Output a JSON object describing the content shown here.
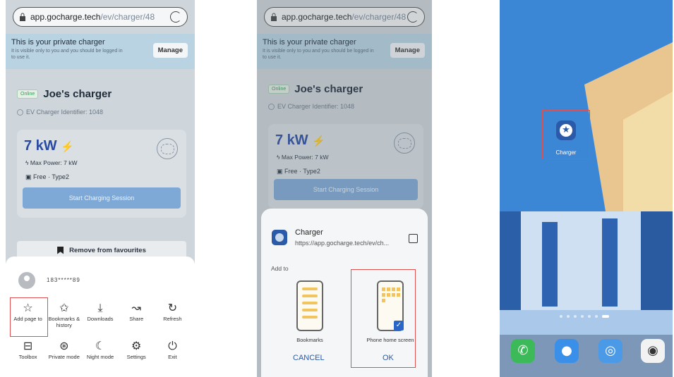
{
  "browser": {
    "url_host": "app.gocharge.tech",
    "url_path": "/ev/charger/48"
  },
  "private_banner": {
    "title": "This is your private charger",
    "subtitle": "It is visible only to you and you should be logged in to use it.",
    "manage_label": "Manage"
  },
  "charger": {
    "status": "Online",
    "name": "Joe's charger",
    "identifier": "EV Charger Identifier: 1048",
    "power": "7 kW",
    "max_power": "Max Power: 7 kW",
    "price_type": "Free · Type2",
    "start_label": "Start Charging Session"
  },
  "favourites_label": "Remove from favourites",
  "menu_sheet": {
    "username": "183*****89",
    "items": [
      {
        "label": "Add page to",
        "icon": "star-icon"
      },
      {
        "label": "Bookmarks & history",
        "icon": "bookmarks-icon"
      },
      {
        "label": "Downloads",
        "icon": "download-icon"
      },
      {
        "label": "Share",
        "icon": "share-icon"
      },
      {
        "label": "Refresh",
        "icon": "refresh-icon"
      },
      {
        "label": "Toolbox",
        "icon": "toolbox-icon"
      },
      {
        "label": "Private mode",
        "icon": "private-mode-icon"
      },
      {
        "label": "Night mode",
        "icon": "moon-icon"
      },
      {
        "label": "Settings",
        "icon": "settings-icon"
      },
      {
        "label": "Exit",
        "icon": "power-icon"
      }
    ]
  },
  "add_sheet": {
    "app_name": "Charger",
    "app_url": "https://app.gocharge.tech/ev/ch...",
    "add_to_label": "Add to",
    "option_bookmarks": "Bookmarks",
    "option_home": "Phone home screen",
    "cancel_label": "CANCEL",
    "ok_label": "OK"
  },
  "home_screen": {
    "shortcut_label": "Charger",
    "dock": [
      {
        "icon": "phone-icon"
      },
      {
        "icon": "messages-icon"
      },
      {
        "icon": "browser-icon"
      },
      {
        "icon": "camera-icon"
      }
    ]
  },
  "colors": {
    "accent": "#2a5aa8",
    "highlight": "#e05050",
    "banner": "#b9d3e3"
  }
}
